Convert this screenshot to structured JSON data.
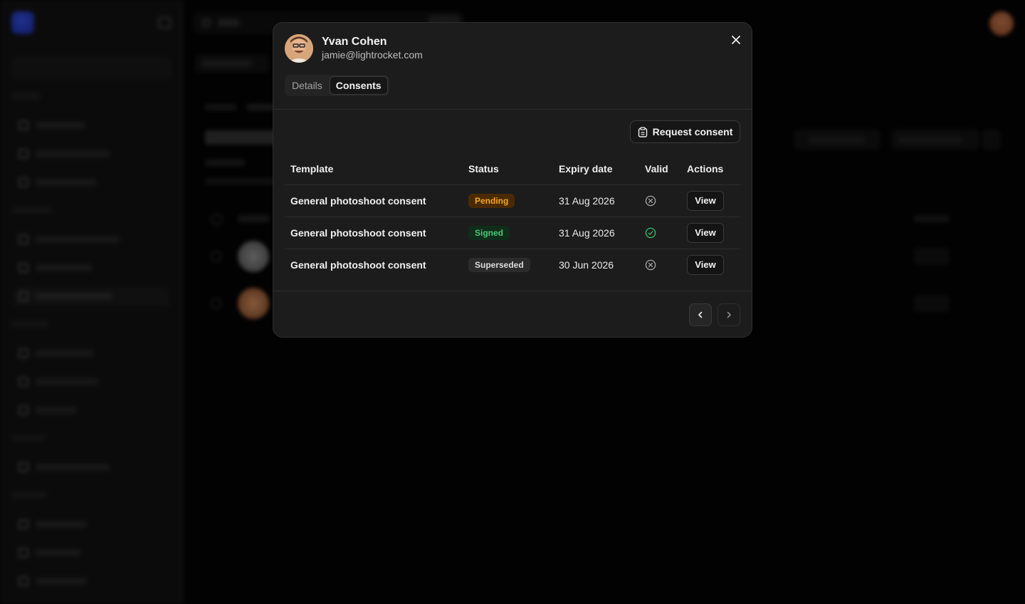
{
  "modal": {
    "person_name": "Yvan Cohen",
    "person_email": "jamie@lightrocket.com",
    "tabs": [
      {
        "label": "Details",
        "active": false
      },
      {
        "label": "Consents",
        "active": true
      }
    ],
    "request_button_label": "Request consent",
    "table": {
      "headers": [
        "Template",
        "Status",
        "Expiry date",
        "Valid",
        "Actions"
      ],
      "rows": [
        {
          "template": "General photoshoot consent",
          "status": "Pending",
          "expiry": "31 Aug 2026",
          "valid": false,
          "action": "View"
        },
        {
          "template": "General photoshoot consent",
          "status": "Signed",
          "expiry": "31 Aug 2026",
          "valid": true,
          "action": "View"
        },
        {
          "template": "General photoshoot consent",
          "status": "Superseded",
          "expiry": "30 Jun 2026",
          "valid": false,
          "action": "View"
        }
      ]
    },
    "icons": {
      "close": "close-icon",
      "request": "clipboard-icon",
      "invalid": "x-circle-icon",
      "valid": "check-circle-icon",
      "prev": "chevron-left-icon",
      "next": "chevron-right-icon"
    }
  },
  "colors": {
    "pending_fg": "#f5a623",
    "signed_fg": "#4ec77a",
    "valid_icon": "#3fbf6e",
    "invalid_icon": "#a8a8a8",
    "brand": "#2f4ff0"
  }
}
